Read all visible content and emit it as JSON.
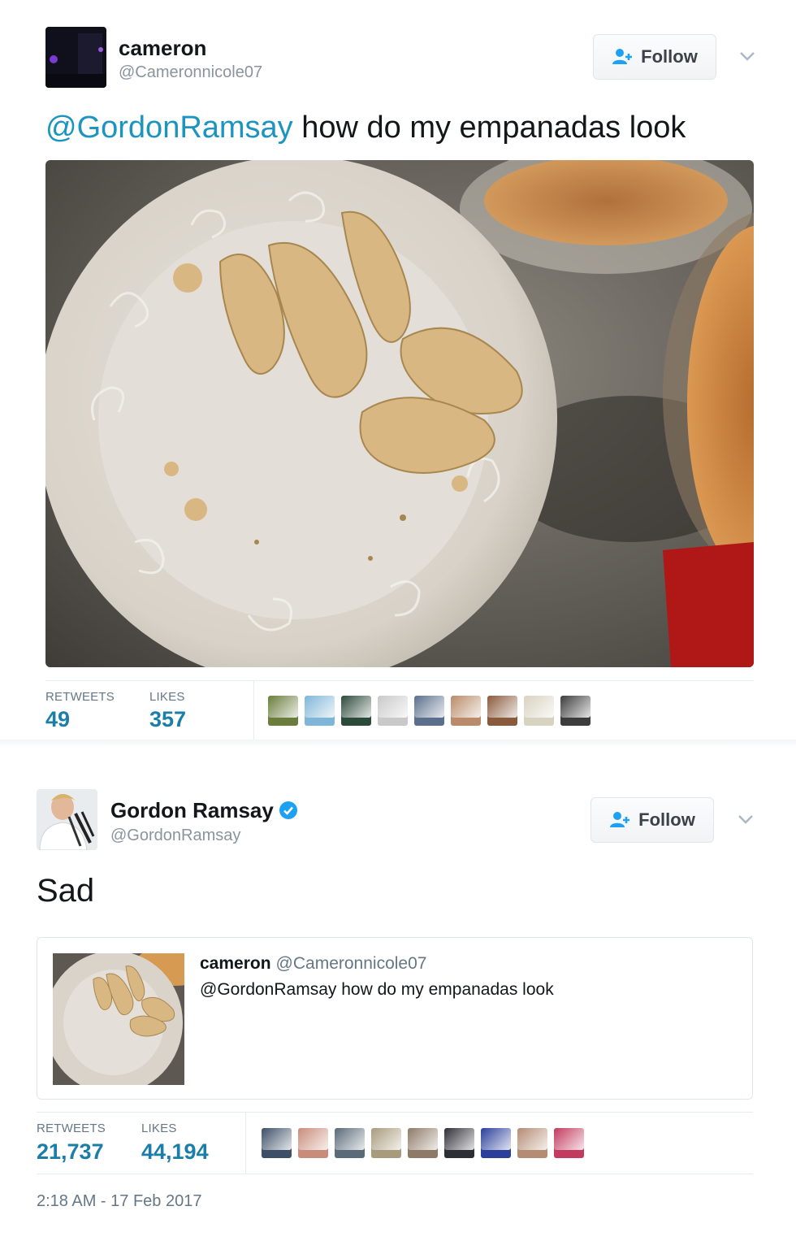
{
  "tweets": [
    {
      "name": "cameron",
      "handle": "@Cameronnicole07",
      "follow_label": "Follow",
      "icons": {
        "follow": "add-user-icon",
        "more": "chevron-down-icon"
      },
      "text_mention": "@GordonRamsay",
      "text_body": " how do my empanadas look",
      "stats": {
        "retweets_label": "RETWEETS",
        "retweets_value": "49",
        "likes_label": "LIKES",
        "likes_value": "357"
      },
      "likers": [
        {
          "color": "#6a7d3c"
        },
        {
          "color": "#7fb6d8"
        },
        {
          "color": "#2c4a3a"
        },
        {
          "color": "#c9c9c9"
        },
        {
          "color": "#5b6f8c"
        },
        {
          "color": "#b98b6a"
        },
        {
          "color": "#8a5a3c"
        },
        {
          "color": "#d8d2c0"
        },
        {
          "color": "#3c3c3c"
        }
      ]
    },
    {
      "name": "Gordon Ramsay",
      "handle": "@GordonRamsay",
      "verified": true,
      "follow_label": "Follow",
      "icons": {
        "follow": "add-user-icon",
        "more": "chevron-down-icon",
        "verified": "verified-badge-icon"
      },
      "text": "Sad",
      "quoted": {
        "name": "cameron",
        "handle": "@Cameronnicole07",
        "text": "@GordonRamsay how do my empanadas look"
      },
      "stats": {
        "retweets_label": "RETWEETS",
        "retweets_value": "21,737",
        "likes_label": "LIKES",
        "likes_value": "44,194"
      },
      "likers": [
        {
          "color": "#3d4f66"
        },
        {
          "color": "#c98c7a"
        },
        {
          "color": "#5a6a78"
        },
        {
          "color": "#a89a7c"
        },
        {
          "color": "#8e7a66"
        },
        {
          "color": "#2e2e36"
        },
        {
          "color": "#2a3e9a"
        },
        {
          "color": "#b48c74"
        },
        {
          "color": "#c23a5e"
        }
      ],
      "timestamp": "2:18 AM - 17 Feb 2017"
    }
  ],
  "colors": {
    "link": "#1b95c0",
    "stat_value": "#1b7ea8",
    "muted": "#657786"
  }
}
